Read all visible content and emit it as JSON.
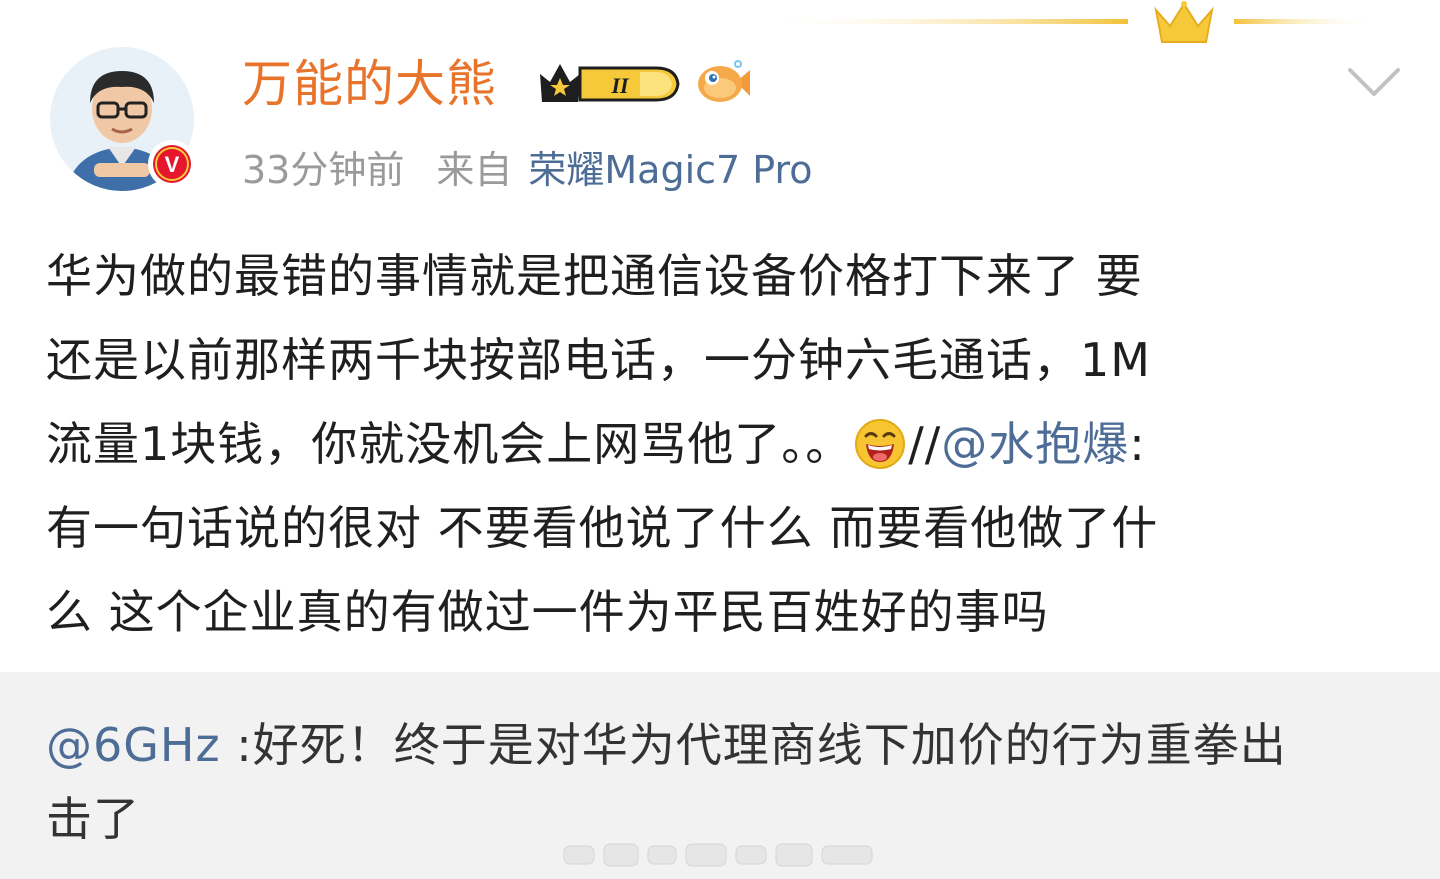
{
  "post": {
    "author": "万能的大熊",
    "level_badge": "II",
    "time": "33分钟前",
    "source_label": "来自",
    "device": "荣耀Magic7 Pro",
    "lines": {
      "l1": "华为做的最错的事情就是把通信设备价格打下来了 要",
      "l2": "还是以前那样两千块按部电话，一分钟六毛通话，1M",
      "l3_a": "流量1块钱，你就没机会上网骂他了。。",
      "l3_b": "//",
      "l3_mention": "@水抱爆",
      "l3_c": ":",
      "l4": "有一句话说的很对 不要看他说了什么 而要看他做了什",
      "l5": "么 这个企业真的有做过一件为平民百姓好的事吗"
    },
    "emoji": "laughing-face-icon",
    "verified_badge": "V"
  },
  "repost": {
    "mention": "@6GHz",
    "text_line1": " :好死！终于是对华为代理商线下加价的行为重拳出",
    "text_line2": "击了"
  },
  "colors": {
    "username": "#e8732a",
    "link": "#4e6d96",
    "meta": "#9a9a9a",
    "body": "#1f1f1f",
    "repost_bg": "#f2f2f2"
  }
}
